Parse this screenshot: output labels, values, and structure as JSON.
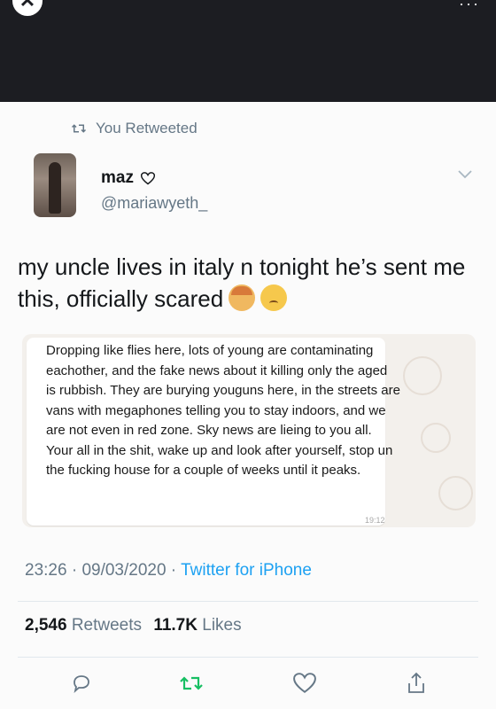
{
  "retweet_banner": "You Retweeted",
  "user": {
    "name": "maz",
    "handle": "@mariawyeth_"
  },
  "tweet_text": "my uncle lives in italy n tonight he’s sent me this, officially scared",
  "message": {
    "text": "Dropping like flies here, lots of young are contaminating eachother, and the fake news about it killing only the aged is rubbish. They are burying youguns here, in the streets are vans with megaphones telling you to stay indoors, and we are not even in red zone. Sky news are lieing to you all. Your all in the shit, wake up and look after yourself, stop un the fucking house for a couple of weeks until it peaks.",
    "time": "19:12"
  },
  "meta": {
    "time": "23:26",
    "date": "09/03/2020",
    "source": "Twitter for iPhone",
    "sep": " · "
  },
  "stats": {
    "retweets_count": "2,546",
    "retweets_label": "Retweets",
    "likes_count": "11.7K",
    "likes_label": "Likes"
  },
  "colors": {
    "topbar": "#1c1d22",
    "muted": "#657786",
    "link": "#1da1f2",
    "retweet_green": "#17bf63"
  }
}
